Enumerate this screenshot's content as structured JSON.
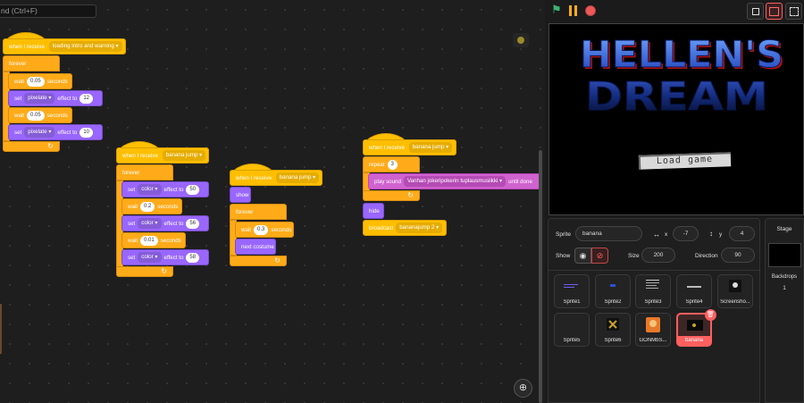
{
  "find": {
    "placeholder": "nd (Ctrl+F)"
  },
  "scripts": {
    "s1": {
      "hat": {
        "label": "when I receive",
        "message": "loading intro and warning"
      },
      "forever": "forever",
      "wait1": {
        "label": "wait",
        "value": "0.05",
        "unit": "seconds"
      },
      "set1": {
        "label": "set",
        "effect": "pixelate",
        "mid": "effect to",
        "value": "12"
      },
      "wait2": {
        "label": "wait",
        "value": "0.05",
        "unit": "seconds"
      },
      "set2": {
        "label": "set",
        "effect": "pixelate",
        "mid": "effect to",
        "value": "10"
      }
    },
    "s2": {
      "hat": {
        "label": "when I receive",
        "message": "banana jump"
      },
      "forever": "forever",
      "set1": {
        "label": "set",
        "effect": "color",
        "mid": "effect to",
        "value": "50"
      },
      "wait1": {
        "label": "wait",
        "value": "0.2",
        "unit": "seconds"
      },
      "set2": {
        "label": "set",
        "effect": "color",
        "mid": "effect to",
        "value": "56"
      },
      "wait2": {
        "label": "wait",
        "value": "0.01",
        "unit": "seconds"
      },
      "set3": {
        "label": "set",
        "effect": "color",
        "mid": "effect to",
        "value": "58"
      }
    },
    "s3": {
      "hat": {
        "label": "when I receive",
        "message": "banana jump"
      },
      "show": "show",
      "forever": "forever",
      "wait1": {
        "label": "wait",
        "value": "0.3",
        "unit": "seconds"
      },
      "next": "next costume"
    },
    "s4": {
      "hat": {
        "label": "when I receive",
        "message": "banana jump"
      },
      "repeat": {
        "label": "repeat",
        "value": "3"
      },
      "play": {
        "label": "play sound",
        "sound": "Vanhan jokeripokerin tuplausmusiikki",
        "suffix": "until done"
      },
      "hide": "hide",
      "broadcast": {
        "label": "broadcast",
        "message": "bananajump 2"
      }
    }
  },
  "stage": {
    "title_line1": "HELLEN'S",
    "title_line2": "DREAM",
    "load_button": "Load game"
  },
  "sprite_info": {
    "sprite_label": "Sprite",
    "name": "banana",
    "x_label": "x",
    "x_value": "-7",
    "y_label": "y",
    "y_value": "4",
    "show_label": "Show",
    "size_label": "Size",
    "size_value": "200",
    "direction_label": "Direction",
    "direction_value": "90"
  },
  "sprites": [
    {
      "name": "Sprite1"
    },
    {
      "name": "Sprite2"
    },
    {
      "name": "Sprite3"
    },
    {
      "name": "Sprite4"
    },
    {
      "name": "Screensho..."
    },
    {
      "name": "Sprite5"
    },
    {
      "name": "Sprite6"
    },
    {
      "name": "GONMbS..."
    },
    {
      "name": "banana",
      "selected": true
    }
  ],
  "stage_panel": {
    "title": "Stage",
    "backdrops_label": "Backdrops",
    "backdrops_count": "1"
  },
  "colors": {
    "events": "#ffbf00",
    "control": "#ffab19",
    "looks": "#9966ff",
    "sound": "#cf63cf",
    "selected": "#ff5f5f"
  }
}
